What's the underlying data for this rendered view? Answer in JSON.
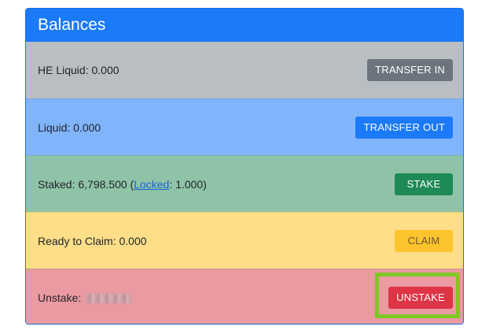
{
  "card": {
    "title": "Balances"
  },
  "rows": {
    "he_liquid": {
      "label": "HE Liquid: 0.000",
      "button": "TRANSFER IN"
    },
    "liquid": {
      "label": "Liquid: 0.000",
      "button": "TRANSFER OUT"
    },
    "staked": {
      "label_prefix": "Staked: 6,798.500 (",
      "locked_link": "Locked",
      "label_suffix": ": 1.000)",
      "button": "STAKE"
    },
    "claim": {
      "label": "Ready to Claim: 0.000",
      "button": "CLAIM"
    },
    "unstake": {
      "label": "Unstake:",
      "button": "UNSTAKE"
    }
  },
  "colors": {
    "header": "#1a7af8",
    "row_he_liquid": "#b9bec3",
    "row_liquid": "#80b4fb",
    "row_staked": "#8fc3a8",
    "row_claim": "#fede88",
    "row_unstake": "#eb9aa2",
    "highlight": "#7ec725"
  }
}
